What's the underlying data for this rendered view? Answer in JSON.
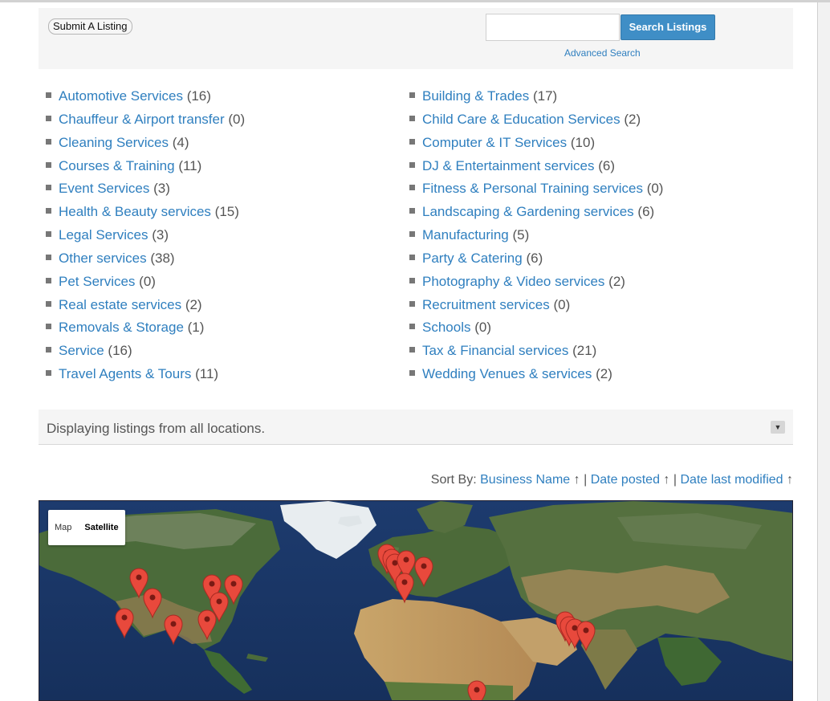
{
  "toolbar": {
    "submit_label": "Submit A Listing",
    "search_placeholder": "",
    "search_button": "Search Listings",
    "advanced_search": "Advanced Search"
  },
  "categories": {
    "left": [
      {
        "name": "Automotive Services",
        "count": "(16)"
      },
      {
        "name": "Chauffeur & Airport transfer",
        "count": "(0)"
      },
      {
        "name": "Cleaning Services",
        "count": "(4)"
      },
      {
        "name": "Courses & Training",
        "count": "(11)"
      },
      {
        "name": "Event Services",
        "count": "(3)"
      },
      {
        "name": "Health & Beauty services",
        "count": "(15)"
      },
      {
        "name": "Legal Services",
        "count": "(3)"
      },
      {
        "name": "Other services",
        "count": "(38)"
      },
      {
        "name": "Pet Services",
        "count": "(0)"
      },
      {
        "name": "Real estate services",
        "count": "(2)"
      },
      {
        "name": "Removals & Storage",
        "count": "(1)"
      },
      {
        "name": "Service",
        "count": "(16)"
      },
      {
        "name": "Travel Agents & Tours",
        "count": "(11)"
      }
    ],
    "right": [
      {
        "name": "Building & Trades",
        "count": "(17)"
      },
      {
        "name": "Child Care & Education Services",
        "count": "(2)"
      },
      {
        "name": "Computer & IT Services",
        "count": "(10)"
      },
      {
        "name": "DJ & Entertainment services",
        "count": "(6)"
      },
      {
        "name": "Fitness & Personal Training services",
        "count": "(0)"
      },
      {
        "name": "Landscaping & Gardening services",
        "count": "(6)"
      },
      {
        "name": "Manufacturing",
        "count": "(5)"
      },
      {
        "name": "Party & Catering",
        "count": "(6)"
      },
      {
        "name": "Photography & Video services",
        "count": "(2)"
      },
      {
        "name": "Recruitment services",
        "count": "(0)"
      },
      {
        "name": "Schools",
        "count": "(0)"
      },
      {
        "name": "Tax & Financial services",
        "count": "(21)"
      },
      {
        "name": "Wedding Venues & services",
        "count": "(2)"
      }
    ]
  },
  "location": {
    "text": "Displaying listings from all locations.",
    "toggle_icon": "triangle-down-icon"
  },
  "sort": {
    "label": "Sort By:",
    "options": [
      {
        "label": "Business Name",
        "arrow": "↑"
      },
      {
        "label": "Date posted",
        "arrow": "↑"
      },
      {
        "label": "Date last modified",
        "arrow": "↑"
      }
    ],
    "separator": "|"
  },
  "map": {
    "type_map": "Map",
    "type_satellite": "Satellite",
    "active": "Satellite",
    "marker_color": "#e8493c"
  },
  "colors": {
    "link": "#2f7fbf",
    "button": "#3f8ec6"
  }
}
